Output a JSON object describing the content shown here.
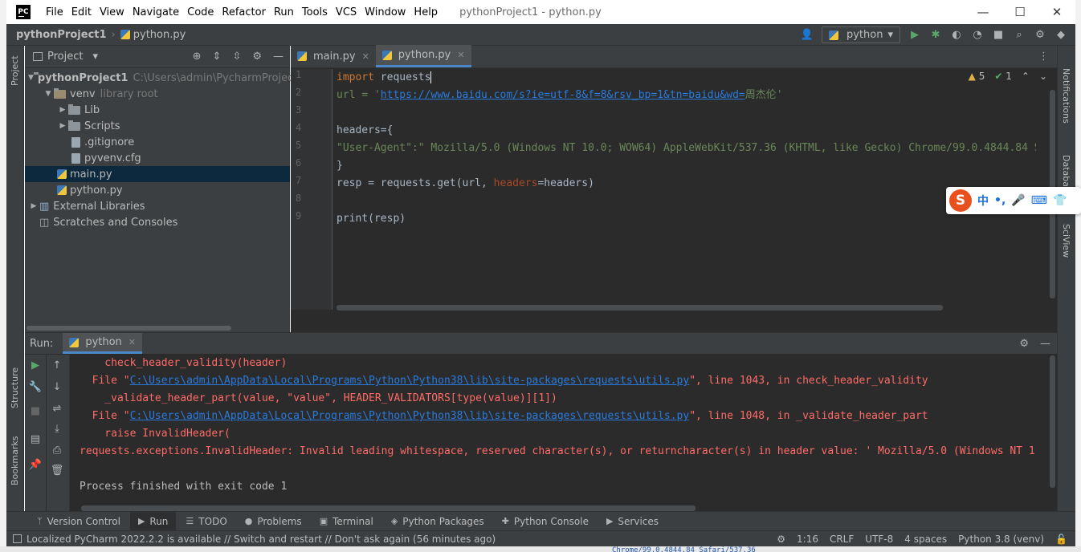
{
  "titlebar": {
    "logo": "PC",
    "menus": [
      "File",
      "Edit",
      "View",
      "Navigate",
      "Code",
      "Refactor",
      "Run",
      "Tools",
      "VCS",
      "Window",
      "Help"
    ],
    "window_title": "pythonProject1 - python.py"
  },
  "navbar": {
    "project": "pythonProject1",
    "file": "python.py",
    "run_config": "python"
  },
  "stripes": {
    "left_top": "Project",
    "left_bottom1": "Structure",
    "left_bottom2": "Bookmarks",
    "right1": "Notifications",
    "right2": "Database",
    "right3": "SciView"
  },
  "project_panel": {
    "title": "Project",
    "tree": [
      {
        "label": "pythonProject1",
        "hint": "C:\\Users\\admin\\PycharmProjects"
      },
      {
        "label": "venv",
        "hint": "library root"
      },
      {
        "label": "Lib"
      },
      {
        "label": "Scripts"
      },
      {
        "label": ".gitignore"
      },
      {
        "label": "pyvenv.cfg"
      },
      {
        "label": "main.py"
      },
      {
        "label": "python.py"
      },
      {
        "label": "External Libraries"
      },
      {
        "label": "Scratches and Consoles"
      }
    ]
  },
  "editor": {
    "tabs": [
      {
        "label": "main.py"
      },
      {
        "label": "python.py"
      }
    ],
    "warnings": "5",
    "ok_count": "1",
    "line_numbers": [
      "1",
      "2",
      "3",
      "4",
      "5",
      "6",
      "7",
      "8",
      "9"
    ],
    "code": {
      "l1_kw": "import",
      "l1_rest": " requests",
      "l2_a": "url = '",
      "l2_url": "https://www.baidu.com/s?ie=utf-8&f=8&rsv_bp=1&tn=baidu&wd=",
      "l2_b": "周杰伦'",
      "l4": "headers={",
      "l5": "\"User-Agent\":\" Mozilla/5.0 (Windows NT 10.0; WOW64) AppleWebKit/537.36 (KHTML, like Gecko) Chrome/99.0.4844.84 S",
      "l6": "}",
      "l7_a": "resp = requests.get(url, ",
      "l7_param": "headers",
      "l7_b": "=headers)",
      "l9": "print(resp)"
    }
  },
  "ime": {
    "logo": "S",
    "items": [
      "中",
      "•,",
      "🎤",
      "⌨",
      "👕"
    ]
  },
  "run_panel": {
    "label": "Run:",
    "tab": "python",
    "lines": {
      "c1": "    check_header_validity(header)",
      "c2_a": "  File \"",
      "c2_link": "C:\\Users\\admin\\AppData\\Local\\Programs\\Python\\Python38\\lib\\site-packages\\requests\\utils.py",
      "c2_b": "\", line 1043, in check_header_validity",
      "c3": "    _validate_header_part(value, \"value\", HEADER_VALIDATORS[type(value)][1])",
      "c4_a": "  File \"",
      "c4_link": "C:\\Users\\admin\\AppData\\Local\\Programs\\Python\\Python38\\lib\\site-packages\\requests\\utils.py",
      "c4_b": "\", line 1048, in _validate_header_part",
      "c5": "    raise InvalidHeader(",
      "c6": "requests.exceptions.InvalidHeader: Invalid leading whitespace, reserved character(s), or returncharacter(s) in header value: ' Mozilla/5.0 (Windows NT 1",
      "c8": "Process finished with exit code 1"
    }
  },
  "bottom_tabs": [
    "Version Control",
    "Run",
    "TODO",
    "Problems",
    "Terminal",
    "Python Packages",
    "Python Console",
    "Services"
  ],
  "statusbar": {
    "message": "Localized PyCharm 2022.2.2 is available // Switch and restart // Don't ask again (56 minutes ago)",
    "position": "1:16",
    "line_sep": "CRLF",
    "encoding": "UTF-8",
    "indent": "4 spaces",
    "interpreter": "Python 3.8 (venv)"
  },
  "background_text": "Chrome/99.0.4844.84 Safari/537.36"
}
